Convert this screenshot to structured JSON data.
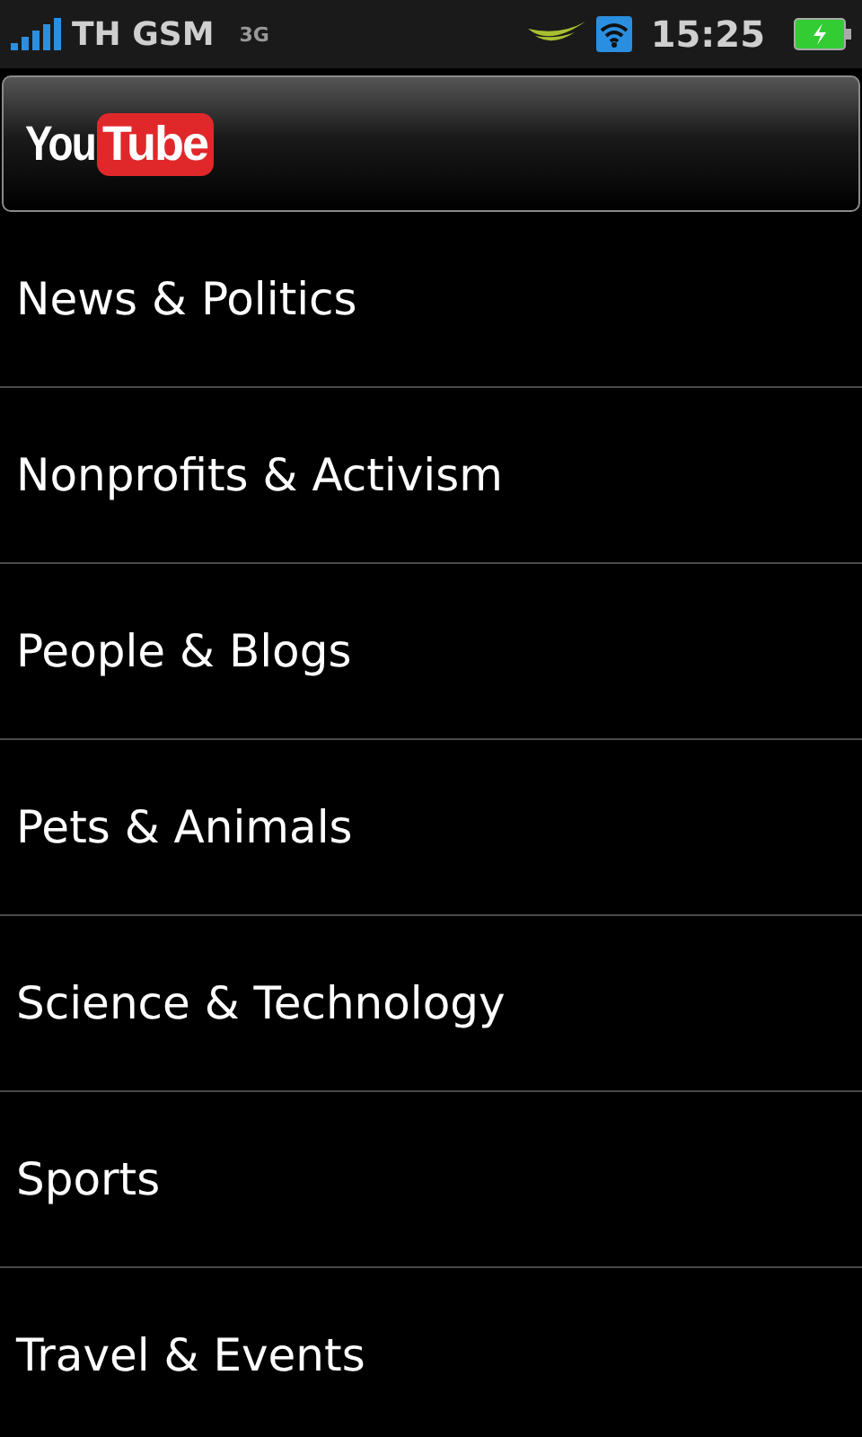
{
  "status_bar": {
    "carrier": "TH GSM",
    "network": "3G",
    "time": "15:25"
  },
  "header": {
    "logo_left": "You",
    "logo_right": "Tube"
  },
  "categories": [
    {
      "label": "News & Politics"
    },
    {
      "label": "Nonprofits & Activism"
    },
    {
      "label": "People & Blogs"
    },
    {
      "label": "Pets & Animals"
    },
    {
      "label": "Science & Technology"
    },
    {
      "label": "Sports"
    },
    {
      "label": "Travel & Events"
    }
  ]
}
